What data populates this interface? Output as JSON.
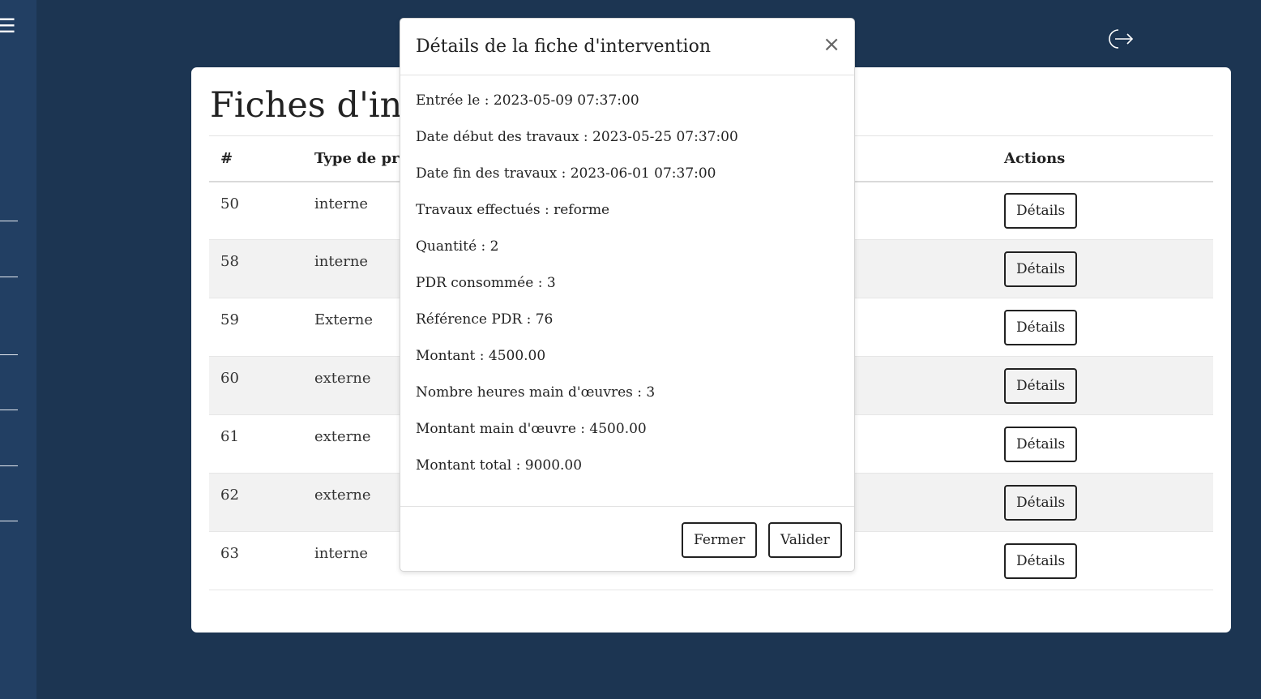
{
  "sidebar": {
    "menu_icon": "☰"
  },
  "header": {
    "logout_icon": "logout-icon"
  },
  "page": {
    "title": "Fiches d'inte",
    "table": {
      "headers": [
        "#",
        "Type de pre",
        "Actions"
      ],
      "rows": [
        {
          "id": "50",
          "type": "interne",
          "action": "Détails"
        },
        {
          "id": "58",
          "type": "interne",
          "action": "Détails"
        },
        {
          "id": "59",
          "type": "Externe",
          "action": "Détails"
        },
        {
          "id": "60",
          "type": "externe",
          "action": "Détails"
        },
        {
          "id": "61",
          "type": "externe",
          "action": "Détails"
        },
        {
          "id": "62",
          "type": "externe",
          "action": "Détails"
        },
        {
          "id": "63",
          "type": "interne",
          "action": "Détails"
        }
      ]
    }
  },
  "modal": {
    "title": "Détails de la fiche d'intervention",
    "close": "×",
    "lines": [
      "Entrée le : 2023-05-09 07:37:00",
      "Date début des travaux : 2023-05-25 07:37:00",
      "Date fin des travaux : 2023-06-01 07:37:00",
      "Travaux effectués : reforme",
      "Quantité : 2",
      "PDR consommée : 3",
      "Référence PDR : 76",
      "Montant : 4500.00",
      "Nombre heures main d'œuvres : 3",
      "Montant main d'œuvre : 4500.00",
      "Montant total : 9000.00"
    ],
    "buttons": {
      "close": "Fermer",
      "validate": "Valider"
    }
  },
  "colors": {
    "background": "#1c3552",
    "sidebar": "#223f63",
    "stripe": "#f2f2f2"
  }
}
